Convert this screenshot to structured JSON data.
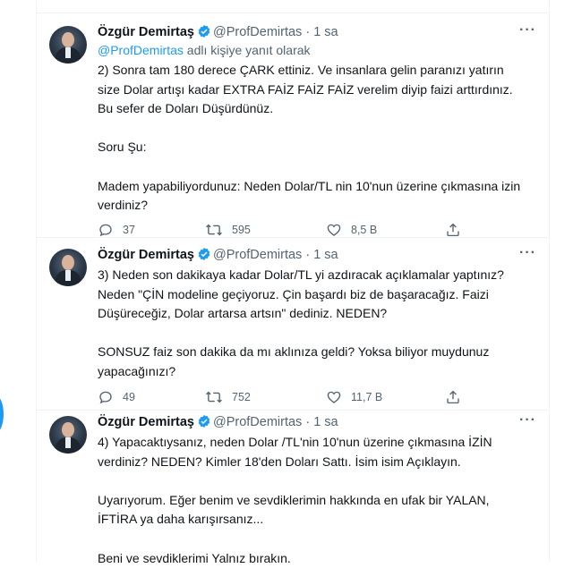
{
  "author": {
    "name": "Özgür Demirtaş",
    "handle": "@ProfDemirtas",
    "separator": "·"
  },
  "tweets": [
    {
      "time": "1 sa",
      "replying_mention": "@ProfDemirtas",
      "replying_suffix": " adlı kişiye yanıt olarak",
      "text": "2) Sonra tam 180 derece ÇARK ettiniz. Ve insanlara gelin paranızı yatırın\nsize Dolar artışı kadar EXTRA FAİZ FAİZ FAİZ verelim diyip faizi arttırdınız.\nBu sefer de Doları Düşürdünüz.\n\nSoru Şu:\n\nMadem yapabiliyordunuz: Neden Dolar/TL nin 10'nun üzerine çıkmasına izin\nverdiniz?",
      "replies": "37",
      "retweets": "595",
      "likes": "8,5 B"
    },
    {
      "time": "1 sa",
      "text": "3) Neden son dakikaya kadar Dolar/TL yi azdıracak açıklamalar yaptınız?\nNeden \"ÇİN modeline geçiyoruz. Çin başardı biz de başaracağız. Faizi\nDüşüreceğiz, Dolar artarsa artsın\" dediniz. NEDEN?\n\nSONSUZ faiz son dakika da mı aklınıza geldi? Yoksa biliyor muydunuz\nyapacağınızı?",
      "replies": "49",
      "retweets": "752",
      "likes": "11,7 B"
    },
    {
      "time": "1 sa",
      "text": "4) Yapacaktıysanız, neden Dolar /TL'nin 10'nun üzerine çıkmasına İZİN\nverdiniz? NEDEN? Kimler 18'den Doları Sattı. İsim isim Açıklayın.\n\nUyarıyorum. Eğer benim ve sevdiklerimin hakkında en ufak bir YALAN,\nİFTİRA ya daha karışırsanız...\n\nBeni ve sevdiklerimi Yalnız bırakın."
    }
  ],
  "icons": {
    "verified": "verified-badge-icon",
    "more": "more-horizontal-icon",
    "reply": "reply-bubble-icon",
    "retweet": "retweet-icon",
    "like": "heart-icon",
    "share": "share-icon"
  },
  "colors": {
    "accent": "#1d9bf0",
    "text": "#0f1419",
    "secondary": "#536471",
    "border": "#eff3f4"
  }
}
